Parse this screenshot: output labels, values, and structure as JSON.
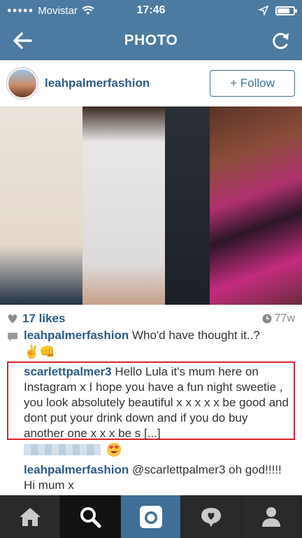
{
  "status_bar": {
    "carrier": "Movistar",
    "time": "17:46",
    "battery_level": 0.7
  },
  "nav": {
    "title": "PHOTO"
  },
  "post": {
    "username": "leahpalmerfashion",
    "follow_label": "+ Follow",
    "likes": "17 likes",
    "age": "77w"
  },
  "comments": [
    {
      "author": "leahpalmerfashion",
      "text": "Who'd have thought it..?",
      "emojis": "✌👊"
    },
    {
      "author": "scarlettpalmer3",
      "text": "Hello Lula it's mum here on Instagram x I hope you have a fun night sweetie , you look absolutely beautiful x x x x x be good and dont put your drink down and if you do buy another one  x x x be s [...]"
    },
    {
      "author": "leahpalmerfashion",
      "text": "@scarlettpalmer3 oh god!!!!! Hi mum x"
    }
  ],
  "colors": {
    "header_bg": "#4c7aa0",
    "link": "#2c5b85",
    "highlight_border": "#d8232a",
    "tab_bar_bg": "#2a2a2a",
    "camera_tab_bg": "#3f6e96"
  },
  "icons": {
    "back": "arrow-left-icon",
    "refresh": "refresh-icon",
    "like": "heart-icon",
    "clock": "clock-icon",
    "comment": "speech-bubble-icon",
    "tabs": [
      "home-icon",
      "search-icon",
      "camera-icon",
      "activity-icon",
      "profile-icon"
    ]
  }
}
